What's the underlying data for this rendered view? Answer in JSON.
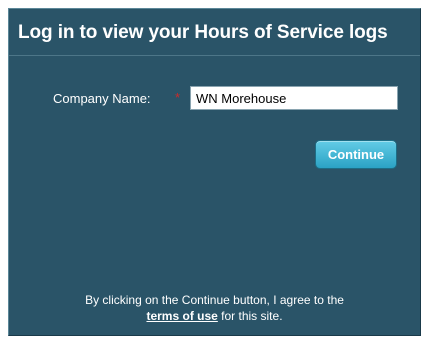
{
  "login": {
    "title": "Log in to view your Hours of Service logs",
    "company_label": "Company Name:",
    "required_mark": "*",
    "company_value": "WN Morehouse",
    "continue_label": "Continue"
  },
  "agreement": {
    "line1": "By clicking on the Continue button, I agree to the",
    "link_text": "terms of use",
    "line2_suffix": "for this site."
  },
  "colors": {
    "panel_background": "#2a5468",
    "button_accent": "#3bb3d6",
    "required_mark": "#cc2a2a"
  }
}
